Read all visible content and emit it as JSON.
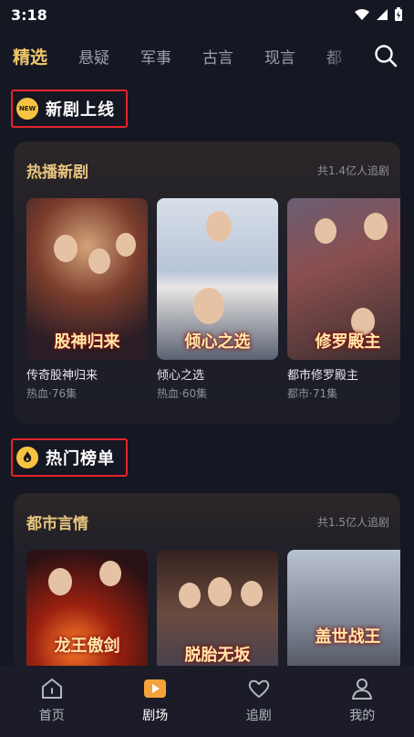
{
  "status": {
    "time": "3:18"
  },
  "tabs": [
    {
      "label": "精选",
      "active": true
    },
    {
      "label": "悬疑"
    },
    {
      "label": "军事"
    },
    {
      "label": "古言"
    },
    {
      "label": "现言"
    },
    {
      "label": "都"
    }
  ],
  "icons": {
    "search": "search-icon",
    "new": "new-badge-icon",
    "hot": "hot-flame-icon"
  },
  "sections": {
    "new": {
      "title": "新剧上线",
      "badge": "NEW"
    },
    "hot": {
      "title": "热门榜单"
    }
  },
  "cards": [
    {
      "title": "热播新剧",
      "meta": "共1.4亿人追剧",
      "items": [
        {
          "name": "传奇股神归来",
          "sub": "热血·76集",
          "caption": "股神归来"
        },
        {
          "name": "倾心之选",
          "sub": "热血·60集",
          "caption": "倾心之选"
        },
        {
          "name": "都市修罗殿主",
          "sub": "都市·71集",
          "caption": "修罗殿主"
        }
      ]
    },
    {
      "title": "都市言情",
      "meta": "共1.5亿人追剧",
      "items": [
        {
          "caption": "龙王傲剑"
        },
        {
          "caption": "脱胎无坂"
        },
        {
          "caption": "盖世战王"
        }
      ]
    }
  ],
  "bottom_nav": [
    {
      "label": "首页",
      "icon": "home-icon"
    },
    {
      "label": "剧场",
      "icon": "theater-play-icon",
      "active": true
    },
    {
      "label": "追剧",
      "icon": "heart-icon"
    },
    {
      "label": "我的",
      "icon": "profile-icon"
    }
  ],
  "colors": {
    "accent": "#f1c76b",
    "highlight_box": "#e3242b",
    "active_nav": "#f6a23a",
    "background": "#151722"
  }
}
